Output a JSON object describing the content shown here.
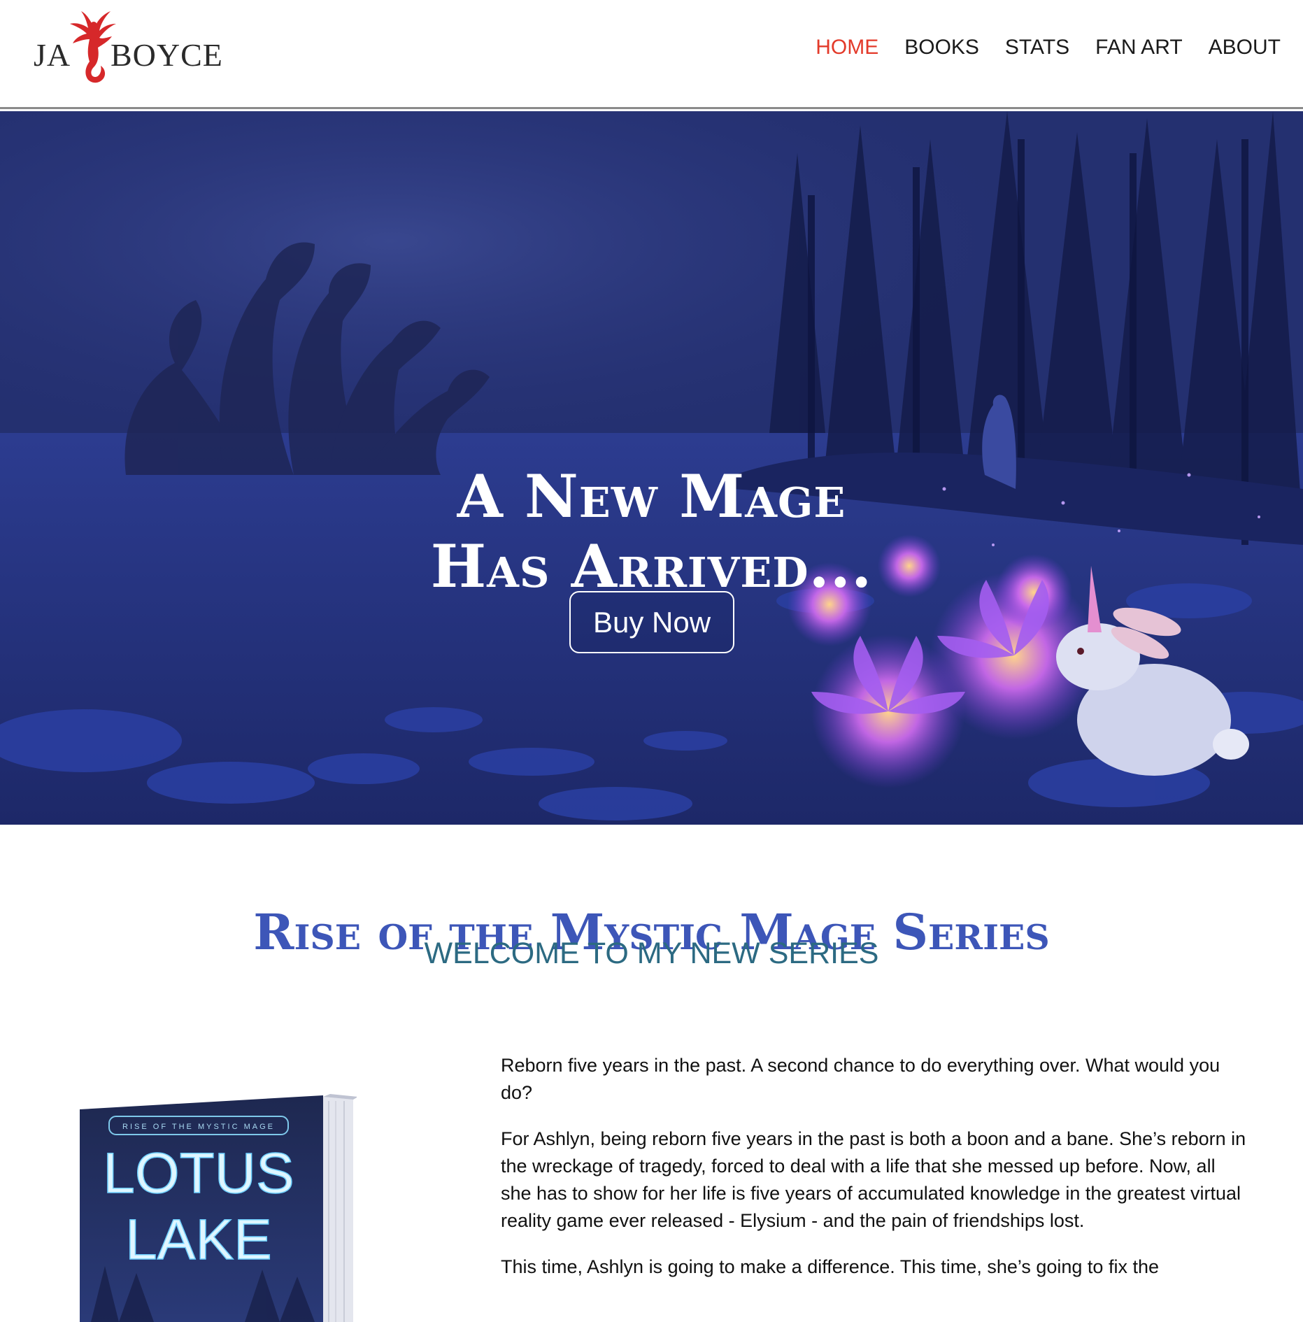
{
  "brand": {
    "name_part1": "JA",
    "name_part2": "BOYCE"
  },
  "nav": {
    "items": [
      {
        "label": "HOME",
        "active": true
      },
      {
        "label": "BOOKS",
        "active": false
      },
      {
        "label": "STATS",
        "active": false
      },
      {
        "label": "FAN ART",
        "active": false
      },
      {
        "label": "ABOUT",
        "active": false
      }
    ]
  },
  "hero": {
    "title_line1": "A New Mage",
    "title_line2": "Has Arrived...",
    "cta_label": "Buy Now"
  },
  "series": {
    "title": "Rise of the Mystic Mage Series",
    "subtitle": "WELCOME TO MY NEW SERIES"
  },
  "book": {
    "series_banner": "RISE OF THE MYSTIC MAGE",
    "title_line1": "LOTUS",
    "title_line2": "LAKE"
  },
  "description": {
    "paragraphs": [
      "Reborn five years in the past. A second chance to do everything over. What would you do?",
      "For Ashlyn, being reborn five years in the past is both a boon and a bane. She’s reborn in the wreckage of tragedy, forced to deal with a life that she messed up before. Now, all she has to show for her life is five years of accumulated knowledge in the greatest virtual reality game ever released - Elysium - and the pain of friendships lost.",
      "This time, Ashlyn is going to make a difference. This time, she’s going to fix the"
    ]
  },
  "colors": {
    "nav_active": "#e33a2a",
    "series_title": "#3d56b8",
    "series_subtitle": "#2c6a82",
    "logo_bird": "#d6282a"
  }
}
